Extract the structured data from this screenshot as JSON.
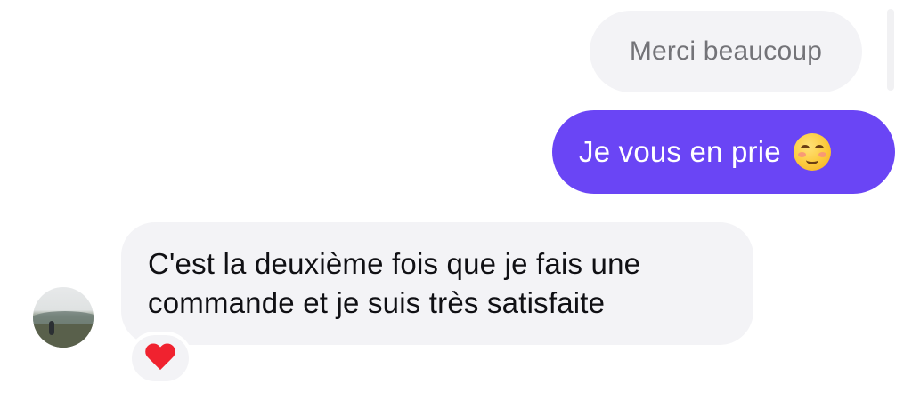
{
  "messages": {
    "quoted": {
      "text": "Merci beaucoup"
    },
    "sent": {
      "text": "Je vous en prie",
      "emoji": "smiling-face-icon"
    },
    "received": {
      "line1": "C'est la deuxième fois que je fais une",
      "line2": "commande et je suis très satisfaite",
      "reaction": "red-heart-icon"
    }
  },
  "colors": {
    "sent_bubble": "#6a45f5",
    "received_bubble": "#f3f3f6",
    "quoted_text": "#737378",
    "received_text": "#101014",
    "reaction_heart": "#f0222f"
  }
}
